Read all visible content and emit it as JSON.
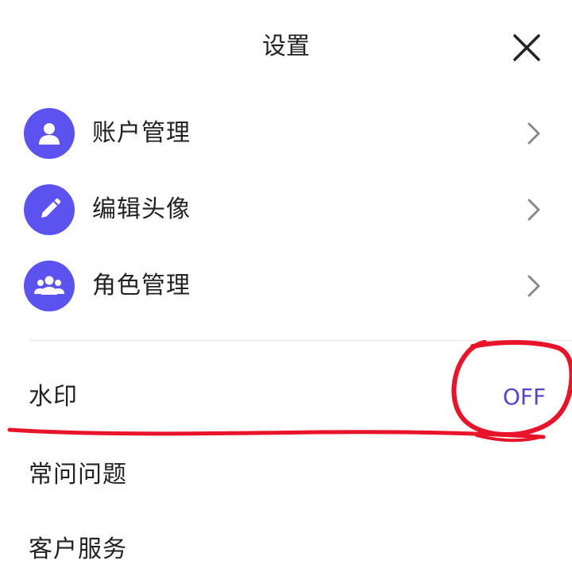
{
  "header": {
    "title": "设置",
    "close_icon": "close-icon"
  },
  "menu": {
    "items": [
      {
        "label": "账户管理",
        "icon": "user-icon"
      },
      {
        "label": "编辑头像",
        "icon": "pencil-icon"
      },
      {
        "label": "角色管理",
        "icon": "group-icon"
      }
    ]
  },
  "settings": {
    "watermark_label": "水印",
    "watermark_value": "OFF",
    "faq_label": "常问问题",
    "support_label": "客户服务"
  },
  "colors": {
    "accent": "#5b52f0",
    "toggle_text": "#5148c9",
    "annotation": "#e8152a"
  }
}
